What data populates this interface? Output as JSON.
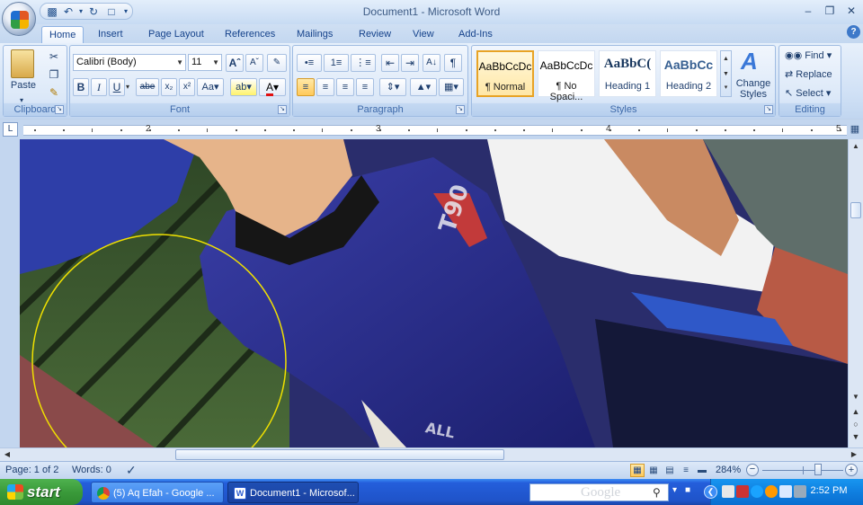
{
  "app": {
    "title": "Document1 - Microsoft Word"
  },
  "tabs": [
    "Home",
    "Insert",
    "Page Layout",
    "References",
    "Mailings",
    "Review",
    "View",
    "Add-Ins"
  ],
  "clipboard": {
    "paste_label": "Paste",
    "group_label": "Clipboard"
  },
  "font": {
    "name": "Calibri (Body)",
    "size": "11",
    "group_label": "Font"
  },
  "paragraph": {
    "group_label": "Paragraph"
  },
  "styles": {
    "items": [
      {
        "sample": "AaBbCcDc",
        "name": "¶ Normal"
      },
      {
        "sample": "AaBbCcDc",
        "name": "¶ No Spaci..."
      },
      {
        "sample": "AaBbC(",
        "name": "Heading 1"
      },
      {
        "sample": "AaBbCc",
        "name": "Heading 2"
      }
    ],
    "change_label": "Change Styles",
    "group_label": "Styles"
  },
  "editing": {
    "find": "Find",
    "replace": "Replace",
    "select": "Select",
    "group_label": "Editing"
  },
  "ruler": {
    "numbers": [
      "2",
      "3",
      "4",
      "5"
    ]
  },
  "status": {
    "page": "Page: 1 of 2",
    "words": "Words: 0",
    "zoom": "284%"
  },
  "taskbar": {
    "start": "start",
    "items": [
      "(5) Aq Efah - Google ...",
      "Document1 - Microsof..."
    ],
    "search_placeholder": "Google",
    "clock": "2:52 PM"
  },
  "colors": {
    "accent": "#15428b",
    "taskbar": "#245edb",
    "start": "#3a9a3a",
    "annotation_circle": "#f0e000"
  }
}
